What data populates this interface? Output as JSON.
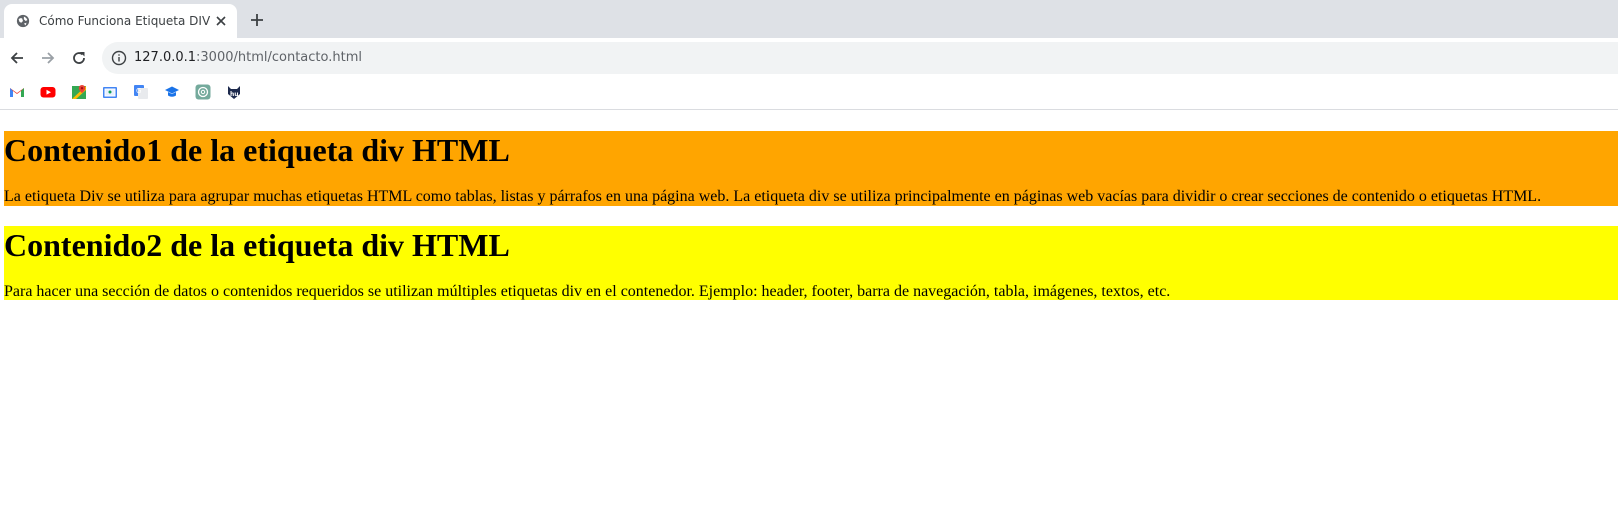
{
  "browser": {
    "tab": {
      "title": "Cómo Funciona Etiqueta DIV",
      "favicon": "globe-icon"
    },
    "toolbar": {
      "url_host": "127.0.0.1",
      "url_path": ":3000/html/contacto.html"
    },
    "bookmarks": [
      {
        "icon": "gmail-icon"
      },
      {
        "icon": "youtube-icon"
      },
      {
        "icon": "maps-icon"
      },
      {
        "icon": "classroom-icon"
      },
      {
        "icon": "translate-icon"
      },
      {
        "icon": "school-icon"
      },
      {
        "icon": "chatgpt-icon"
      },
      {
        "icon": "hu-icon"
      }
    ]
  },
  "page": {
    "sections": [
      {
        "heading": "Contenido1 de la etiqueta div HTML",
        "text": "La etiqueta Div se utiliza para agrupar muchas etiquetas HTML como tablas, listas y párrafos en una página web. La etiqueta div se utiliza principalmente en páginas web vacías para dividir o crear secciones de contenido o etiquetas HTML.",
        "background": "#ffa500"
      },
      {
        "heading": "Contenido2 de la etiqueta div HTML",
        "text": "Para hacer una sección de datos o contenidos requeridos se utilizan múltiples etiquetas div en el contenedor. Ejemplo: header, footer, barra de navegación, tabla, imágenes, textos, etc.",
        "background": "#ffff00"
      }
    ]
  }
}
